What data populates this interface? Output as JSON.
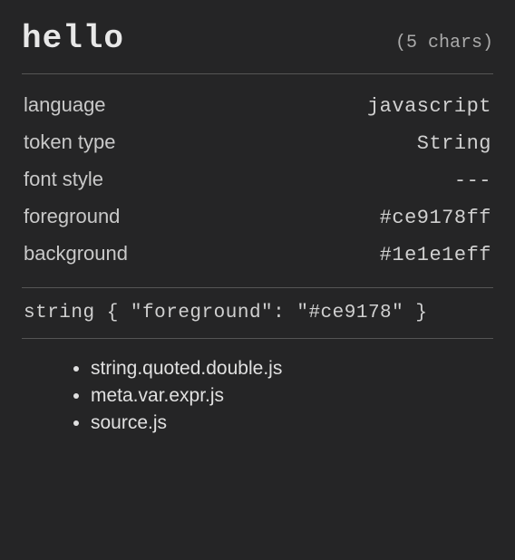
{
  "header": {
    "token": "hello",
    "charCount": "(5 chars)"
  },
  "properties": {
    "language": {
      "label": "language",
      "value": "javascript"
    },
    "tokenType": {
      "label": "token type",
      "value": "String"
    },
    "fontStyle": {
      "label": "font style",
      "value": "---"
    },
    "foreground": {
      "label": "foreground",
      "value": "#ce9178ff"
    },
    "background": {
      "label": "background",
      "value": "#1e1e1eff"
    }
  },
  "rule": "string { \"foreground\": \"#ce9178\" }",
  "scopes": [
    "string.quoted.double.js",
    "meta.var.expr.js",
    "source.js"
  ]
}
